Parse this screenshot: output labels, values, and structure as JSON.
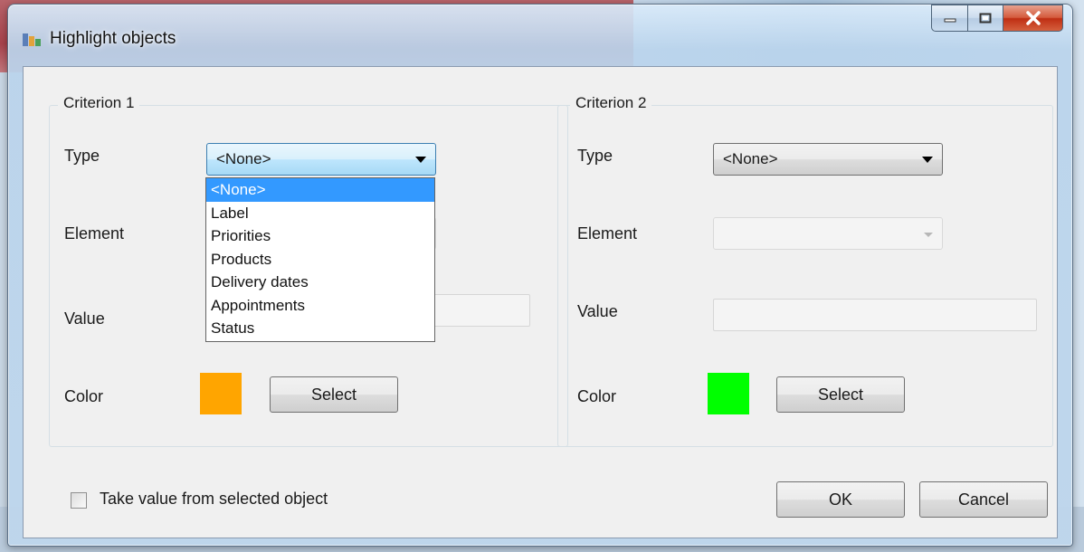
{
  "window": {
    "title": "Highlight objects"
  },
  "criterion1": {
    "legend": "Criterion 1",
    "type_label": "Type",
    "type_value": "<None>",
    "type_options": [
      "<None>",
      "Label",
      "Priorities",
      "Products",
      "Delivery dates",
      "Appointments",
      "Status"
    ],
    "selected_option": "<None>",
    "element_label": "Element",
    "value_label": "Value",
    "color_label": "Color",
    "color": "#ffa500",
    "select_label": "Select"
  },
  "criterion2": {
    "legend": "Criterion 2",
    "type_label": "Type",
    "type_value": "<None>",
    "element_label": "Element",
    "value_label": "Value",
    "color_label": "Color",
    "color": "#00ff00",
    "select_label": "Select"
  },
  "footer": {
    "checkbox_label": "Take value from selected object",
    "checkbox_checked": false,
    "ok_label": "OK",
    "cancel_label": "Cancel"
  }
}
